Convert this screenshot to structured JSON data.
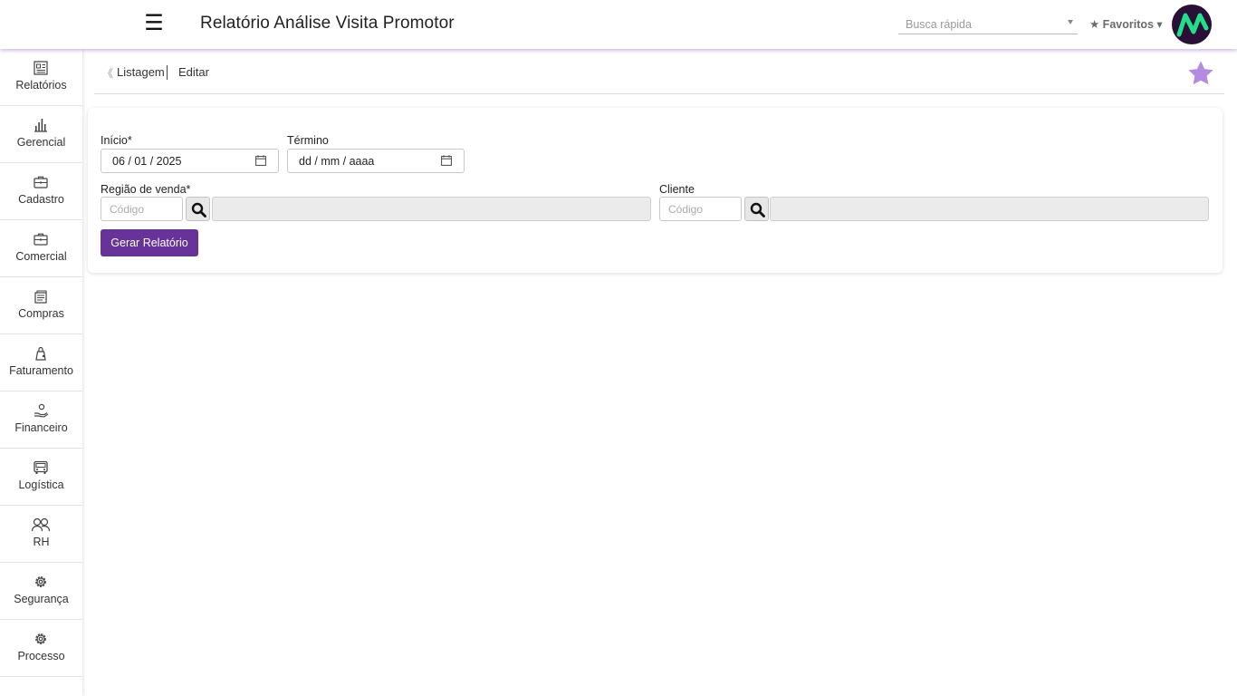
{
  "header": {
    "menu_icon": "hamburger-menu-icon",
    "title": "Relatório Análise Visita Promotor",
    "quick_search_placeholder": "Busca rápida",
    "favorites_label": "★ Favoritos ▾",
    "logo_colors": {
      "background": "#2a1036",
      "mark": "#22e08a"
    }
  },
  "sidebar": {
    "items": [
      {
        "label": "Relatórios",
        "icon": "newspaper-icon"
      },
      {
        "label": "Gerencial",
        "icon": "bar-chart-icon"
      },
      {
        "label": "Cadastro",
        "icon": "briefcase-icon"
      },
      {
        "label": "Comercial",
        "icon": "briefcase-icon"
      },
      {
        "label": "Compras",
        "icon": "stacked-documents-icon"
      },
      {
        "label": "Faturamento",
        "icon": "receipt-bag-icon"
      },
      {
        "label": "Financeiro",
        "icon": "money-hand-icon"
      },
      {
        "label": "Logística",
        "icon": "truck-icon"
      },
      {
        "label": "RH",
        "icon": "people-icon"
      },
      {
        "label": "Segurança",
        "icon": "gear-icon"
      },
      {
        "label": "Processo",
        "icon": "gear-icon"
      }
    ]
  },
  "breadcrumb": {
    "back_icon": "double-chevron-left-icon",
    "list_label": "Listagem",
    "edit_label": "Editar"
  },
  "favorite_star": {
    "icon": "star-icon",
    "color": "#b48be0"
  },
  "form": {
    "inicio_label": "Início*",
    "inicio_value": "06 / 01 / 2025",
    "termino_label": "Término",
    "termino_value": "dd / mm / aaaa",
    "regiao_label": "Região de venda*",
    "regiao_code_placeholder": "Código",
    "cliente_label": "Cliente",
    "cliente_code_placeholder": "Código",
    "generate_button": "Gerar Relatório",
    "accent_color": "#673399"
  }
}
